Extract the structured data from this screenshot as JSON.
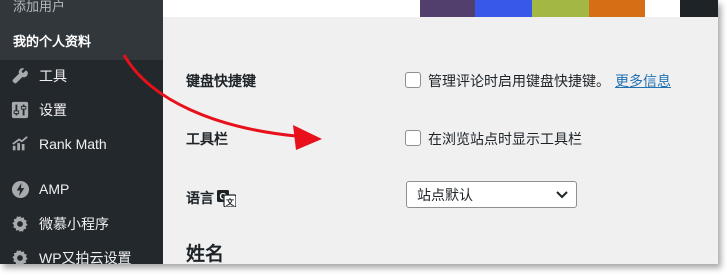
{
  "sidebar": {
    "submenu": {
      "clipped_item": "添加用户",
      "current_item": "我的个人资料"
    },
    "items": [
      {
        "label": "工具",
        "icon": "wrench-icon"
      },
      {
        "label": "设置",
        "icon": "settings-sliders-icon"
      },
      {
        "label": "Rank Math",
        "icon": "rank-math-chart-icon"
      },
      {
        "label": "AMP",
        "icon": "amp-bolt-icon"
      },
      {
        "label": "微慕小程序",
        "icon": "gear-icon"
      },
      {
        "label": "WP又拍云设置",
        "icon": "gear-icon"
      }
    ]
  },
  "color_scheme": {
    "colors": [
      "#523f6d",
      "#3858e9",
      "#a3b745",
      "#d46f15"
    ]
  },
  "profile": {
    "keyboard_shortcuts": {
      "label": "键盘快捷键",
      "checkbox_text": "管理评论时启用键盘快捷键。",
      "link_text": "更多信息",
      "checked": false
    },
    "toolbar": {
      "label": "工具栏",
      "checkbox_text": "在浏览站点时显示工具栏",
      "checked": false
    },
    "language": {
      "label": "语言",
      "icon": "translation-icon",
      "selected": "站点默认"
    },
    "name_section": {
      "title": "姓名"
    }
  },
  "annotation": {
    "arrow_color": "#e8101a"
  }
}
